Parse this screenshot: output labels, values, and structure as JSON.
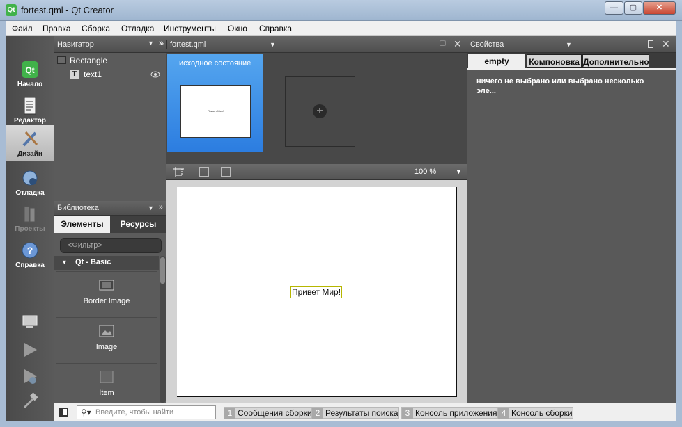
{
  "window": {
    "title": "fortest.qml - Qt Creator",
    "app_icon_text": "Qt",
    "minimize": "—",
    "maximize": "▢",
    "close": "✕"
  },
  "menu": [
    "Файл",
    "Правка",
    "Сборка",
    "Отладка",
    "Инструменты",
    "Окно",
    "Справка"
  ],
  "modes": [
    {
      "label": "Начало",
      "state": "normal"
    },
    {
      "label": "Редактор",
      "state": "normal"
    },
    {
      "label": "Дизайн",
      "state": "active"
    },
    {
      "label": "Отладка",
      "state": "normal"
    },
    {
      "label": "Проекты",
      "state": "disabled"
    },
    {
      "label": "Справка",
      "state": "normal"
    }
  ],
  "navigator": {
    "title": "Навигатор",
    "items": [
      {
        "label": "Rectangle"
      },
      {
        "label": "text1"
      }
    ]
  },
  "library": {
    "title": "Библиотека",
    "tabs": [
      "Элементы",
      "Ресурсы"
    ],
    "filter_placeholder": "<Фильтр>",
    "group": "Qt - Basic",
    "items": [
      "Border Image",
      "Image",
      "Item"
    ]
  },
  "document": {
    "file": "fortest.qml",
    "state_name": "исходное состояние",
    "thumb_text": "Привет Мир!",
    "zoom": "100 %",
    "canvas_text": "Привет Мир!"
  },
  "properties": {
    "title": "Свойства",
    "tabs": [
      "empty",
      "Компоновка",
      "Дополнительно"
    ],
    "message": "ничего не выбрано или выбрано несколько эле..."
  },
  "statusbar": {
    "search_placeholder": "Введите, чтобы найти",
    "tabs": [
      {
        "num": "1",
        "label": "Сообщения сборки"
      },
      {
        "num": "2",
        "label": "Результаты поиска"
      },
      {
        "num": "3",
        "label": "Консоль приложения"
      },
      {
        "num": "4",
        "label": "Консоль сборки"
      }
    ]
  },
  "colors": {
    "active_state": "#2c7de0",
    "panel": "#5b5b5b",
    "header": "#4f4f4f"
  }
}
